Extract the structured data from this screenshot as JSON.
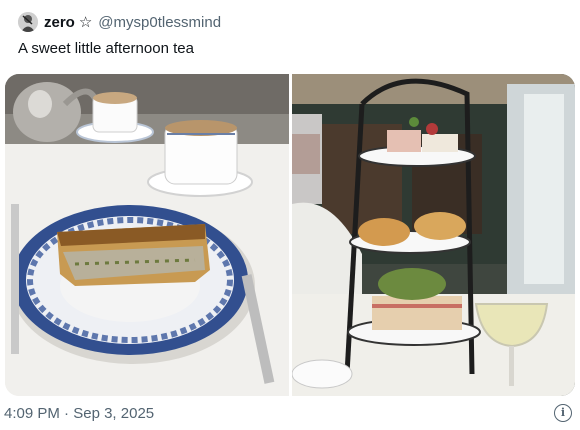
{
  "author": {
    "display_name": "zero",
    "handle": "@mysp0tlessmind",
    "badge_icon": "star-outline-icon"
  },
  "tweet": {
    "text": "A sweet little afternoon tea"
  },
  "media": {
    "left_photo": "quiche-slice-on-blue-plate",
    "right_photo": "afternoon-tea-stand-with-wine"
  },
  "footer": {
    "time": "4:09 PM",
    "separator": "·",
    "date": "Sep 3, 2025",
    "info_icon": "info-icon"
  }
}
